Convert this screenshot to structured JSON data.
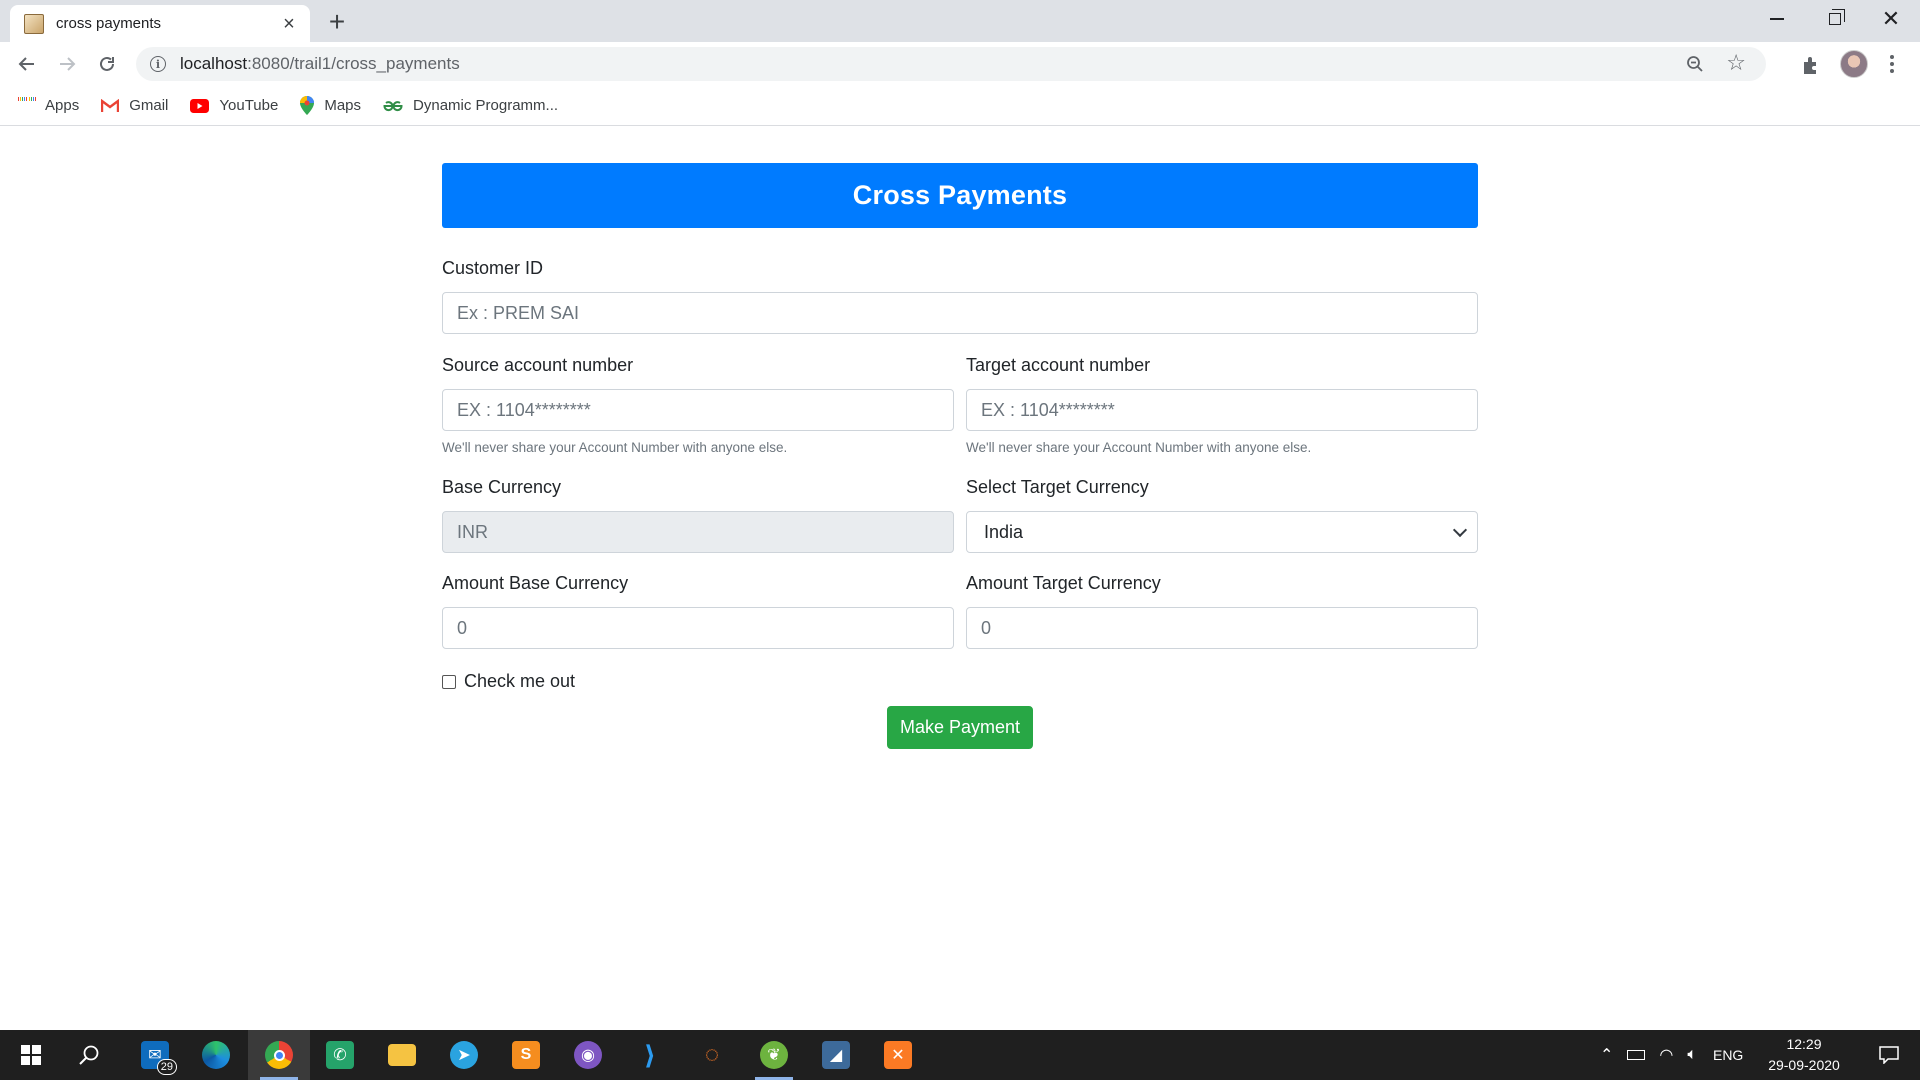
{
  "browser": {
    "tab_title": "cross payments",
    "url_host": "localhost",
    "url_path": ":8080/trail1/cross_payments",
    "bookmarks": [
      {
        "label": "Apps",
        "icon": "apps-grid-icon"
      },
      {
        "label": "Gmail",
        "icon": "gmail-icon"
      },
      {
        "label": "YouTube",
        "icon": "youtube-icon"
      },
      {
        "label": "Maps",
        "icon": "maps-pin-icon"
      },
      {
        "label": "Dynamic Programm...",
        "icon": "geeksforgeeks-icon"
      }
    ]
  },
  "form": {
    "title": "Cross Payments",
    "customer_id": {
      "label": "Customer ID",
      "placeholder": "Ex : PREM SAI"
    },
    "source_account": {
      "label": "Source account number",
      "placeholder": "EX : 1104********",
      "help": "We'll never share your Account Number with anyone else."
    },
    "target_account": {
      "label": "Target account number",
      "placeholder": "EX : 1104********",
      "help": "We'll never share your Account Number with anyone else."
    },
    "base_currency": {
      "label": "Base Currency",
      "value": "INR"
    },
    "target_currency": {
      "label": "Select Target Currency",
      "selected": "India"
    },
    "amount_base": {
      "label": "Amount Base Currency",
      "placeholder": "0"
    },
    "amount_target": {
      "label": "Amount Target Currency",
      "placeholder": "0"
    },
    "checkbox_label": "Check me out",
    "submit_label": "Make Payment"
  },
  "taskbar": {
    "mail_badge": "29",
    "language": "ENG",
    "time": "12:29",
    "date": "29-09-2020"
  },
  "colors": {
    "banner": "#007bff",
    "button": "#28a745"
  }
}
